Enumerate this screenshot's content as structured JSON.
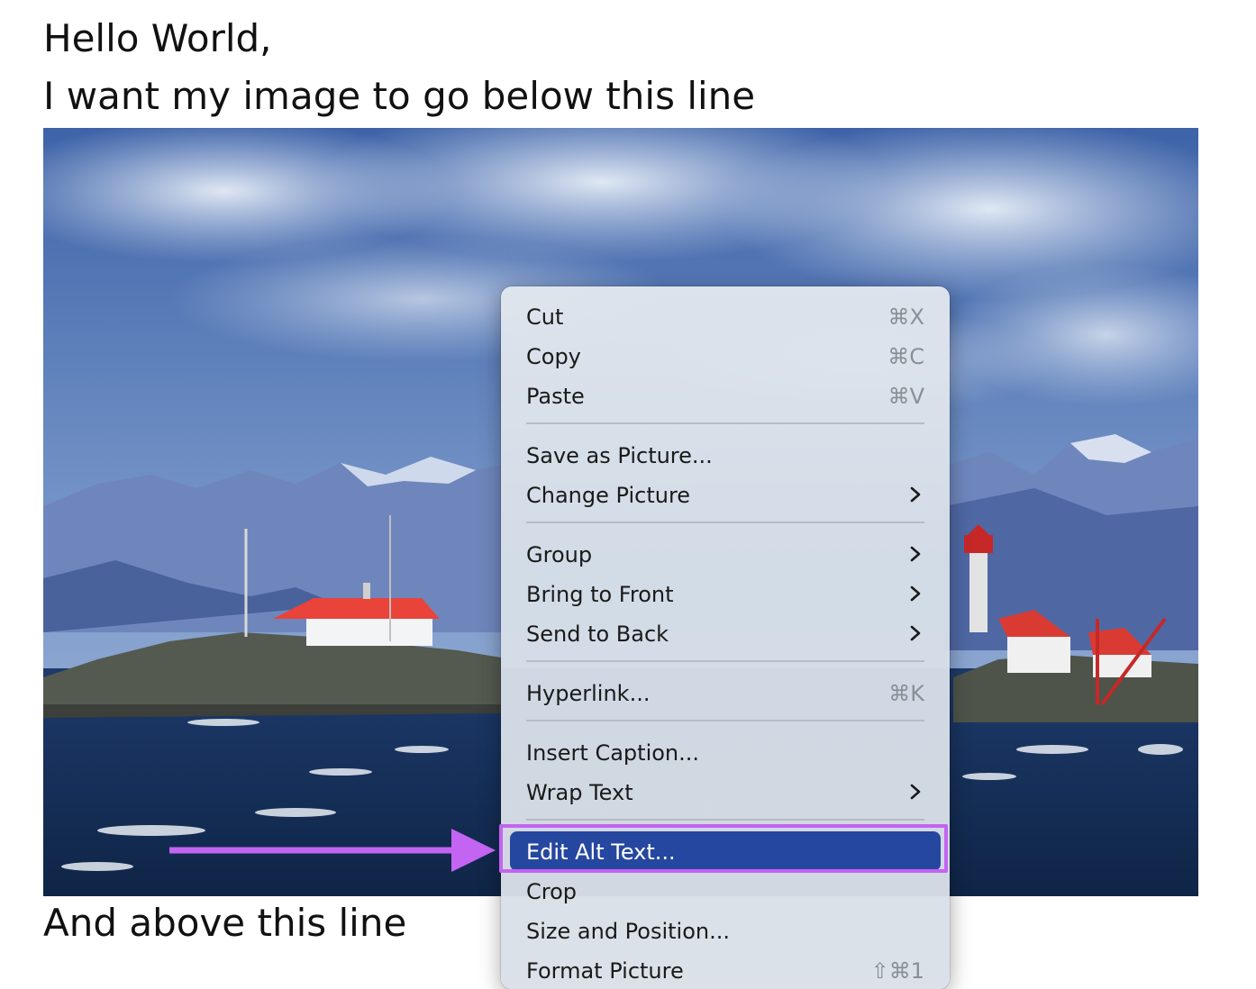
{
  "document": {
    "line1": "Hello World,",
    "line2": "I want my image to go below this line",
    "line3": "And above this line"
  },
  "context_menu": {
    "items": [
      {
        "label": "Cut",
        "shortcut": "⌘X"
      },
      {
        "label": "Copy",
        "shortcut": "⌘C"
      },
      {
        "label": "Paste",
        "shortcut": "⌘V"
      },
      {
        "label": "Save as Picture..."
      },
      {
        "label": "Change Picture",
        "submenu": true
      },
      {
        "label": "Group",
        "submenu": true
      },
      {
        "label": "Bring to Front",
        "submenu": true
      },
      {
        "label": "Send to Back",
        "submenu": true
      },
      {
        "label": "Hyperlink...",
        "shortcut": "⌘K"
      },
      {
        "label": "Insert Caption..."
      },
      {
        "label": "Wrap Text",
        "submenu": true
      },
      {
        "label": "Edit Alt Text...",
        "selected": true
      },
      {
        "label": "Crop"
      },
      {
        "label": "Size and Position..."
      },
      {
        "label": "Format Picture",
        "shortcut": "⇧⌘1"
      }
    ]
  },
  "colors": {
    "highlight": "#c364f2",
    "selected_bg": "#2547a0"
  },
  "icons": [
    "chevron-right-icon",
    "arrow-right-icon"
  ]
}
